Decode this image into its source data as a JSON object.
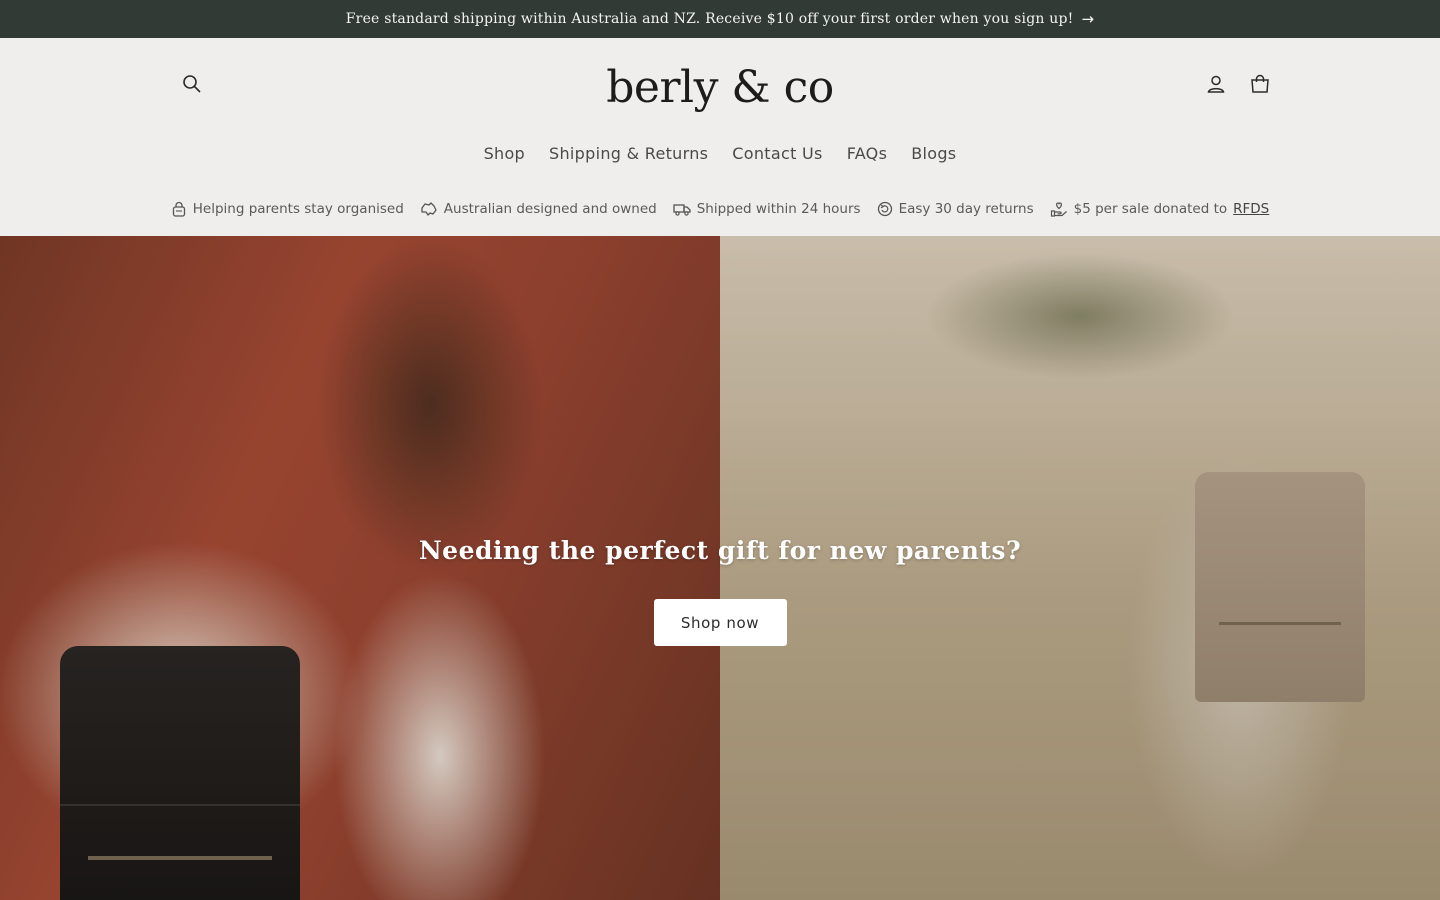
{
  "announcement": {
    "text": "Free standard shipping within Australia and NZ. Receive $10 off your first order when you sign up!",
    "arrow": "→"
  },
  "header": {
    "logo": "berly & co",
    "icons": [
      "search-icon",
      "account-icon",
      "cart-icon"
    ]
  },
  "nav": {
    "items": [
      {
        "label": "Shop"
      },
      {
        "label": "Shipping & Returns"
      },
      {
        "label": "Contact Us"
      },
      {
        "label": "FAQs"
      },
      {
        "label": "Blogs"
      }
    ]
  },
  "usp": {
    "items": [
      {
        "label": "Helping parents stay organised",
        "icon": "bag-icon"
      },
      {
        "label": "Australian designed and owned",
        "icon": "australia-icon"
      },
      {
        "label": "Shipped within 24 hours",
        "icon": "truck-icon"
      },
      {
        "label": "Easy 30 day returns",
        "icon": "returns-icon"
      },
      {
        "label": "$5 per sale donated to",
        "link": "RFDS",
        "icon": "donate-icon"
      }
    ]
  },
  "hero": {
    "headline": "Needing the perfect gift for new parents?",
    "button_label": "Shop now"
  },
  "colors": {
    "announcement_bg": "#313a35",
    "header_bg": "#efeeec",
    "button_bg": "#ffffff"
  }
}
